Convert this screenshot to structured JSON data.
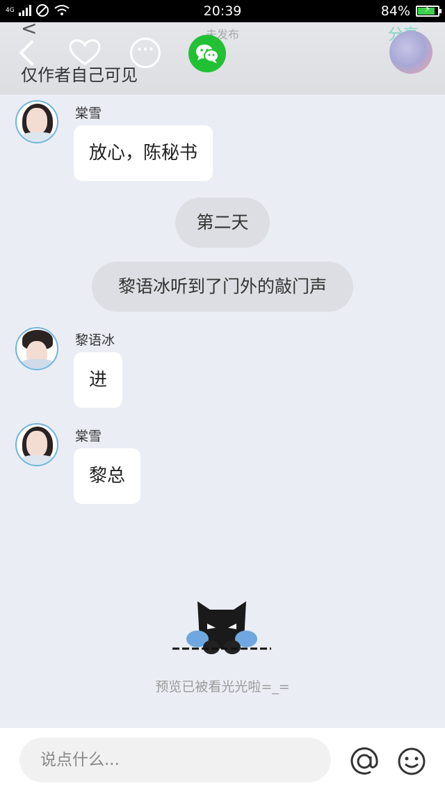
{
  "status_bar": {
    "network": "4G",
    "time": "20:39",
    "battery_percent": "84%",
    "battery_level": 0.84,
    "charging": true
  },
  "header": {
    "faded_title": "未发布",
    "faded_right": "分享",
    "faded_back": "<",
    "more_glyph": "···",
    "visibility_label": "仅作者自己可见"
  },
  "messages": [
    {
      "sender": "棠雪",
      "text": "放心，陈秘书"
    },
    {
      "narration": "第二天"
    },
    {
      "narration": "黎语冰听到了门外的敲门声"
    },
    {
      "sender": "黎语冰",
      "text": "进"
    },
    {
      "sender": "棠雪",
      "text": "黎总"
    }
  ],
  "preview_notice": "预览已被看光光啦=_=",
  "input": {
    "placeholder": "说点什么..."
  },
  "colors": {
    "wechat": "#22c035",
    "chat_background": "#eaedf4",
    "battery_fill": "#3ad24a",
    "avatar_ring": "#6fb4dc"
  }
}
